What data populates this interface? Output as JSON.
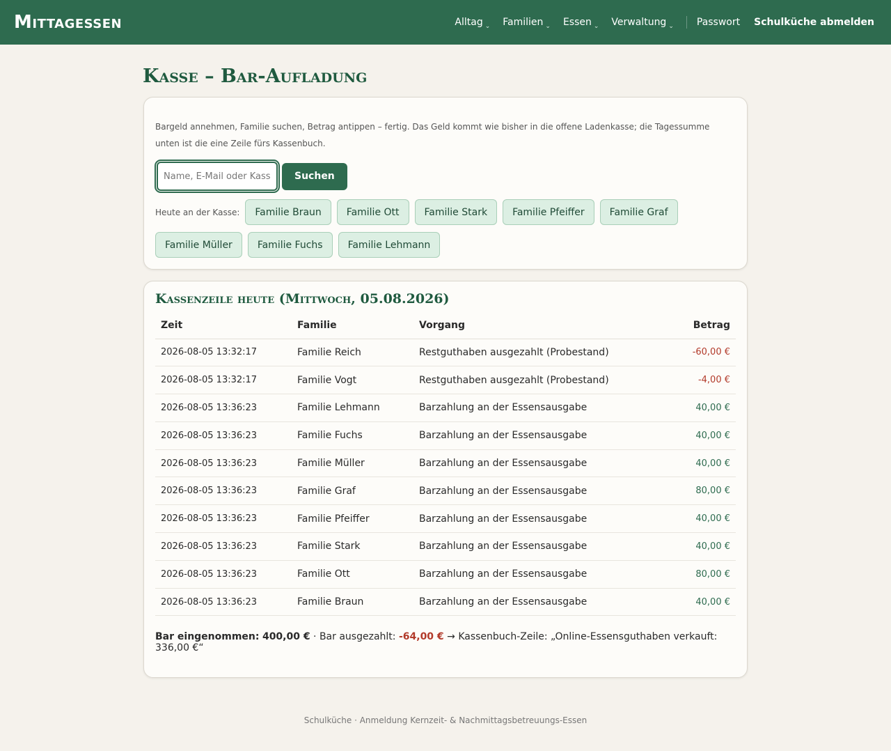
{
  "header": {
    "brand": "Mittagessen",
    "nav": [
      {
        "label": "Alltag"
      },
      {
        "label": "Familien"
      },
      {
        "label": "Essen"
      },
      {
        "label": "Verwaltung"
      }
    ],
    "password_label": "Passwort",
    "logout_label": "Schulküche abmelden"
  },
  "page": {
    "title": "Kasse – Bar-Aufladung"
  },
  "search_card": {
    "intro": "Bargeld annehmen, Familie suchen, Betrag antippen – fertig. Das Geld kommt wie bisher in die offene Ladenkasse; die Tagessumme unten ist die eine Zeile fürs Kassenbuch.",
    "search_placeholder": "Name, E-Mail oder Kassenr.",
    "search_button": "Suchen",
    "chips_label": "Heute an der Kasse:",
    "chips": [
      "Familie Braun",
      "Familie Ott",
      "Familie Stark",
      "Familie Pfeiffer",
      "Familie Graf",
      "Familie Müller",
      "Familie Fuchs",
      "Familie Lehmann"
    ]
  },
  "ledger": {
    "title": "Kassenzeile heute (Mittwoch, 05.08.2026)",
    "columns": {
      "time": "Zeit",
      "family": "Familie",
      "action": "Vorgang",
      "amount": "Betrag"
    },
    "rows": [
      {
        "time": "2026-08-05 13:32:17",
        "family": "Familie Reich",
        "action": "Restguthaben ausgezahlt (Probestand)",
        "amount": "-60,00 €",
        "sign": "neg"
      },
      {
        "time": "2026-08-05 13:32:17",
        "family": "Familie Vogt",
        "action": "Restguthaben ausgezahlt (Probestand)",
        "amount": "-4,00 €",
        "sign": "neg"
      },
      {
        "time": "2026-08-05 13:36:23",
        "family": "Familie Lehmann",
        "action": "Barzahlung an der Essensausgabe",
        "amount": "40,00 €",
        "sign": "pos"
      },
      {
        "time": "2026-08-05 13:36:23",
        "family": "Familie Fuchs",
        "action": "Barzahlung an der Essensausgabe",
        "amount": "40,00 €",
        "sign": "pos"
      },
      {
        "time": "2026-08-05 13:36:23",
        "family": "Familie Müller",
        "action": "Barzahlung an der Essensausgabe",
        "amount": "40,00 €",
        "sign": "pos"
      },
      {
        "time": "2026-08-05 13:36:23",
        "family": "Familie Graf",
        "action": "Barzahlung an der Essensausgabe",
        "amount": "80,00 €",
        "sign": "pos"
      },
      {
        "time": "2026-08-05 13:36:23",
        "family": "Familie Pfeiffer",
        "action": "Barzahlung an der Essensausgabe",
        "amount": "40,00 €",
        "sign": "pos"
      },
      {
        "time": "2026-08-05 13:36:23",
        "family": "Familie Stark",
        "action": "Barzahlung an der Essensausgabe",
        "amount": "40,00 €",
        "sign": "pos"
      },
      {
        "time": "2026-08-05 13:36:23",
        "family": "Familie Ott",
        "action": "Barzahlung an der Essensausgabe",
        "amount": "80,00 €",
        "sign": "pos"
      },
      {
        "time": "2026-08-05 13:36:23",
        "family": "Familie Braun",
        "action": "Barzahlung an der Essensausgabe",
        "amount": "40,00 €",
        "sign": "pos"
      }
    ],
    "summary": {
      "income_label": "Bar eingenommen:",
      "income_value": "400,00 €",
      "sep": "·",
      "payout_label": "Bar ausgezahlt:",
      "payout_value": "-64,00 €",
      "arrow": "→",
      "book_line": "Kassenbuch-Zeile: „Online-Essensguthaben verkauft: 336,00 €“"
    }
  },
  "footer": {
    "text": "Schulküche · Anmeldung Kernzeit- & Nachmittagsbetreuungs-Essen"
  },
  "colors": {
    "brand_green": "#2e6b4f",
    "heading_green": "#1f5a3f",
    "negative": "#b23a2a",
    "chip_bg": "#dcefe3",
    "page_bg": "#f5f2ec"
  }
}
